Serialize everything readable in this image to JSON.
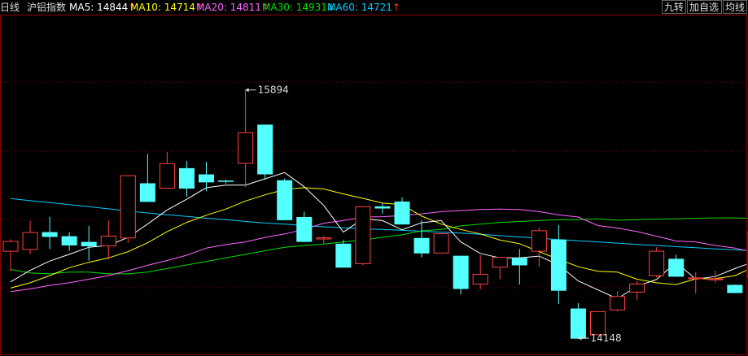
{
  "header": {
    "period": "日线",
    "symbol": "沪铝指数",
    "ma": [
      {
        "label": "MA5:",
        "value": "14844",
        "arrow": "↑",
        "color": "#ffffff",
        "arrow_color": "#ff3030"
      },
      {
        "label": "MA10:",
        "value": "14714",
        "arrow": "↑",
        "color": "#ffff00",
        "arrow_color": "#ff3030"
      },
      {
        "label": "MA20:",
        "value": "14811",
        "arrow": "↑",
        "color": "#ff66ff",
        "arrow_color": "#ff3030"
      },
      {
        "label": "MA30:",
        "value": "14931",
        "arrow": "↓",
        "color": "#00dd00",
        "arrow_color": "#00e5e5"
      },
      {
        "label": "MA60:",
        "value": "14721",
        "arrow": "↑",
        "color": "#00ccff",
        "arrow_color": "#ff3030"
      }
    ]
  },
  "buttons": {
    "nine_turn": "九转",
    "add_watchlist": "加自选",
    "mean_line": "均线"
  },
  "colors": {
    "up": "#ff4040",
    "down": "#54ffff",
    "ma5": "#ffffff",
    "ma10": "#ffff00",
    "ma20": "#ff66ff",
    "ma30": "#00dd00",
    "ma60": "#00ccff",
    "grid": "#8b0000"
  },
  "chart_data": {
    "type": "candlestick",
    "ylim": [
      14130,
      15960
    ],
    "high_label": "15894",
    "low_label": "14148",
    "candles": [
      {
        "o": 14635,
        "h": 14705,
        "l": 14525,
        "c": 14695
      },
      {
        "o": 14645,
        "h": 14808,
        "l": 14620,
        "c": 14745
      },
      {
        "o": 14745,
        "h": 14832,
        "l": 14650,
        "c": 14718
      },
      {
        "o": 14722,
        "h": 14745,
        "l": 14640,
        "c": 14670
      },
      {
        "o": 14690,
        "h": 14780,
        "l": 14585,
        "c": 14665
      },
      {
        "o": 14665,
        "h": 14810,
        "l": 14590,
        "c": 14725
      },
      {
        "o": 14710,
        "h": 15065,
        "l": 14685,
        "c": 15065
      },
      {
        "o": 15020,
        "h": 15185,
        "l": 14920,
        "c": 14915
      },
      {
        "o": 14990,
        "h": 15195,
        "l": 14990,
        "c": 15133
      },
      {
        "o": 15105,
        "h": 15145,
        "l": 14945,
        "c": 14990
      },
      {
        "o": 15070,
        "h": 15140,
        "l": 14975,
        "c": 15025
      },
      {
        "o": 15035,
        "h": 15040,
        "l": 15018,
        "c": 15028
      },
      {
        "o": 15130,
        "h": 15545,
        "l": 14998,
        "c": 15307
      },
      {
        "o": 15350,
        "h": 15350,
        "l": 15040,
        "c": 15070
      },
      {
        "o": 15037,
        "h": 15047,
        "l": 14815,
        "c": 14812
      },
      {
        "o": 14830,
        "h": 14860,
        "l": 14698,
        "c": 14690
      },
      {
        "o": 14704,
        "h": 14725,
        "l": 14680,
        "c": 14715
      },
      {
        "o": 14680,
        "h": 14700,
        "l": 14545,
        "c": 14545
      },
      {
        "o": 14565,
        "h": 14892,
        "l": 14560,
        "c": 14890
      },
      {
        "o": 14890,
        "h": 14908,
        "l": 14850,
        "c": 14878
      },
      {
        "o": 14917,
        "h": 14940,
        "l": 14800,
        "c": 14788
      },
      {
        "o": 14712,
        "h": 14813,
        "l": 14604,
        "c": 14625
      },
      {
        "o": 14625,
        "h": 14716,
        "l": 14625,
        "c": 14738
      },
      {
        "o": 14612,
        "h": 14612,
        "l": 14394,
        "c": 14425
      },
      {
        "o": 14450,
        "h": 14615,
        "l": 14423,
        "c": 14510
      },
      {
        "o": 14545,
        "h": 14580,
        "l": 14480,
        "c": 14605
      },
      {
        "o": 14600,
        "h": 14650,
        "l": 14450,
        "c": 14558
      },
      {
        "o": 14635,
        "h": 14770,
        "l": 14550,
        "c": 14755
      },
      {
        "o": 14703,
        "h": 14785,
        "l": 14340,
        "c": 14415
      },
      {
        "o": 14315,
        "h": 14345,
        "l": 14148,
        "c": 14145
      },
      {
        "o": 14165,
        "h": 14298,
        "l": 14190,
        "c": 14300
      },
      {
        "o": 14305,
        "h": 14412,
        "l": 14298,
        "c": 14385
      },
      {
        "o": 14405,
        "h": 14470,
        "l": 14360,
        "c": 14455
      },
      {
        "o": 14498,
        "h": 14660,
        "l": 14490,
        "c": 14640
      },
      {
        "o": 14595,
        "h": 14618,
        "l": 14498,
        "c": 14494
      },
      {
        "o": 14480,
        "h": 14520,
        "l": 14400,
        "c": 14490
      },
      {
        "o": 14474,
        "h": 14528,
        "l": 14459,
        "c": 14484
      },
      {
        "o": 14448,
        "h": 14450,
        "l": 14405,
        "c": 14402
      },
      {
        "o": 14490,
        "h": 14805,
        "l": 14480,
        "c": 14747
      },
      {
        "o": 14830,
        "h": 14932,
        "l": 14720,
        "c": 14885
      }
    ],
    "ma5": [
      14465,
      14530,
      14582,
      14620,
      14660,
      14670,
      14715,
      14790,
      14870,
      14930,
      14995,
      15010,
      15010,
      15045,
      15080,
      15000,
      14895,
      14745,
      14820,
      14810,
      14758,
      14798,
      14810,
      14690,
      14625,
      14600,
      14600,
      14610,
      14560,
      14470,
      14420,
      14370,
      14440,
      14478,
      14575,
      14480,
      14495,
      14540,
      14580,
      14620
    ],
    "ma10": [
      14430,
      14460,
      14500,
      14545,
      14575,
      14600,
      14635,
      14685,
      14748,
      14800,
      14840,
      14875,
      14920,
      14955,
      14985,
      14995,
      14988,
      14960,
      14935,
      14908,
      14900,
      14835,
      14790,
      14760,
      14735,
      14700,
      14680,
      14635,
      14592,
      14550,
      14525,
      14520,
      14480,
      14460,
      14450,
      14482,
      14483,
      14500,
      14550,
      14560
    ],
    "ma20": [
      14410,
      14425,
      14445,
      14460,
      14480,
      14500,
      14528,
      14558,
      14585,
      14615,
      14655,
      14675,
      14690,
      14715,
      14735,
      14760,
      14795,
      14810,
      14830,
      14832,
      14838,
      14848,
      14860,
      14866,
      14872,
      14875,
      14872,
      14860,
      14842,
      14830,
      14782,
      14768,
      14748,
      14722,
      14695,
      14690,
      14670,
      14655,
      14630,
      14620
    ],
    "ma30": [
      14535,
      14515,
      14510,
      14520,
      14520,
      14510,
      14510,
      14520,
      14540,
      14560,
      14580,
      14600,
      14620,
      14640,
      14660,
      14670,
      14678,
      14690,
      14700,
      14716,
      14730,
      14752,
      14760,
      14780,
      14790,
      14800,
      14805,
      14810,
      14815,
      14815,
      14820,
      14812,
      14815,
      14818,
      14820,
      14823,
      14825,
      14825,
      14822,
      14822
    ],
    "ma60": [
      14934,
      14922,
      14911,
      14900,
      14888,
      14876,
      14863,
      14853,
      14843,
      14833,
      14823,
      14815,
      14805,
      14796,
      14790,
      14782,
      14775,
      14769,
      14763,
      14760,
      14755,
      14750,
      14745,
      14740,
      14733,
      14725,
      14718,
      14710,
      14703,
      14696,
      14690,
      14683,
      14676,
      14670,
      14663,
      14657,
      14650,
      14645,
      14640,
      14640
    ]
  }
}
